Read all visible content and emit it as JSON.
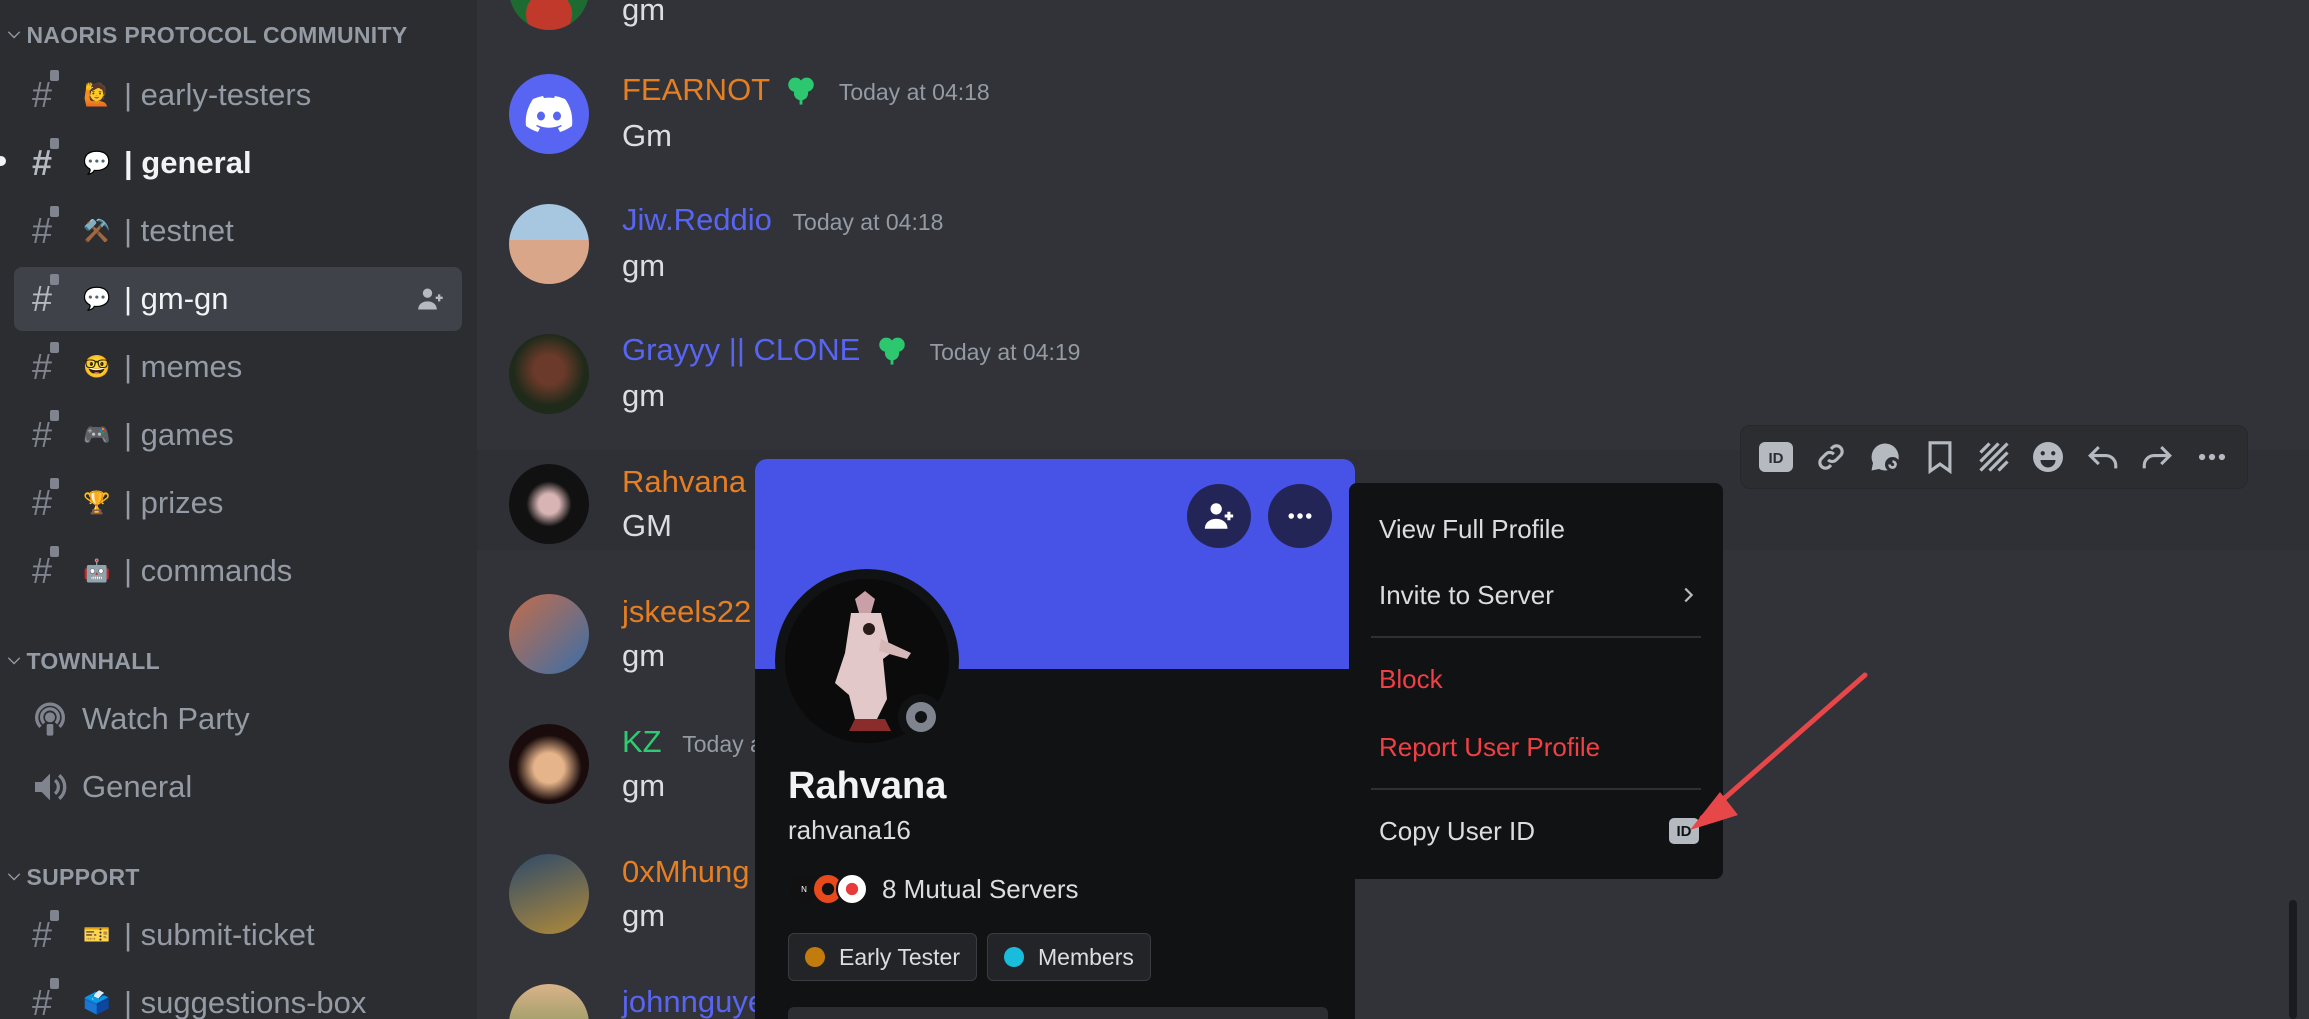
{
  "sidebar": {
    "categories": [
      {
        "label": "NAORIS PROTOCOL COMMUNITY"
      },
      {
        "label": "TOWNHALL"
      },
      {
        "label": "SUPPORT"
      }
    ],
    "channels": [
      {
        "emoji": "🙋",
        "name": "| early-testers"
      },
      {
        "emoji": "💬",
        "name": "| general"
      },
      {
        "emoji": "⚒️",
        "name": "| testnet"
      },
      {
        "emoji": "💬",
        "name": "| gm-gn"
      },
      {
        "emoji": "🤓",
        "name": "| memes"
      },
      {
        "emoji": "🎮",
        "name": "| games"
      },
      {
        "emoji": "🏆",
        "name": "| prizes"
      },
      {
        "emoji": "🤖",
        "name": "| commands"
      },
      {
        "name": "Watch Party"
      },
      {
        "name": "General"
      },
      {
        "emoji": "🎫",
        "name": "| submit-ticket"
      },
      {
        "emoji": "🗳️",
        "name": "| suggestions-box"
      }
    ]
  },
  "messages": [
    {
      "user": "",
      "time": "",
      "text": "gm"
    },
    {
      "user": "FEARNOT",
      "time": "Today at 04:18",
      "text": "Gm",
      "color": "#e67e22"
    },
    {
      "user": "Jiw.Reddio",
      "time": "Today at 04:18",
      "text": "gm",
      "color": "#5865f2"
    },
    {
      "user": "Grayyy || CLONE",
      "time": "Today at 04:19",
      "text": "gm",
      "color": "#5865f2"
    },
    {
      "user": "Rahvana",
      "time": "",
      "text": "GM",
      "color": "#e67e22"
    },
    {
      "user": "jskeels22",
      "time": "",
      "text": "gm",
      "color": "#e67e22"
    },
    {
      "user": "KZ",
      "time": "Today a",
      "text": "gm",
      "color": "#2ecc71"
    },
    {
      "user": "0xMhung",
      "time": "",
      "text": "gm",
      "color": "#e67e22"
    },
    {
      "user": "johnnguye",
      "time": "",
      "text": "",
      "color": "#5865f2"
    }
  ],
  "toolbar": {
    "icons": [
      "id-icon",
      "link-icon",
      "thread-icon",
      "bookmark-icon",
      "super-reaction-icon",
      "emoji-icon",
      "reply-icon",
      "forward-icon",
      "more-icon"
    ]
  },
  "profile": {
    "name": "Rahvana",
    "handle": "rahvana16",
    "mutual_servers": "8 Mutual Servers",
    "banner_color": "#4752e6",
    "roles": [
      {
        "label": "Early Tester",
        "color": "#c27c0e"
      },
      {
        "label": "Members",
        "color": "#1abcdc"
      }
    ]
  },
  "context_menu": {
    "view_profile": "View Full Profile",
    "invite": "Invite to Server",
    "block": "Block",
    "report": "Report User Profile",
    "copy_id": "Copy User ID",
    "id_badge": "ID"
  },
  "colors": {
    "danger": "#f23f43",
    "annotation_arrow": "#e8474a"
  }
}
